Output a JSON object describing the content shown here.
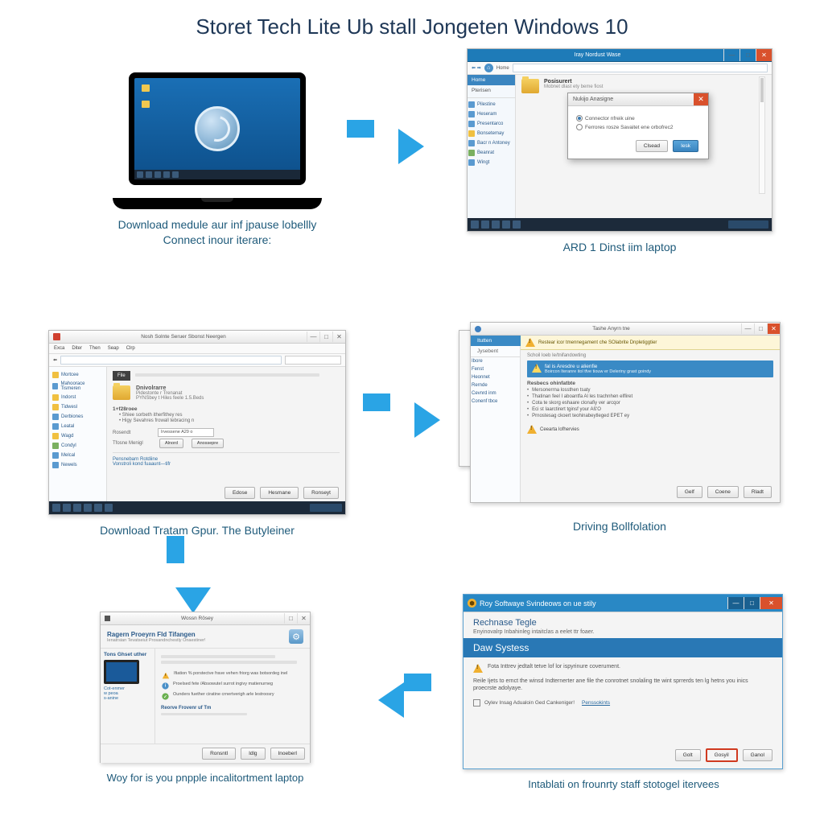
{
  "title": "Storet Tech Lite Ub stall Jongeten Windows 10",
  "steps": {
    "s1": {
      "caption_line1": "Download medule aur inf jpause lobellly",
      "caption_line2": "Connect inour iterare:"
    },
    "s2": {
      "caption": "ARD 1 Dinst iim laptop",
      "win_title": "Iray Nordust Wase",
      "addr_label": "Home",
      "tab_home": "Home",
      "tab_other": "Pterisen",
      "sidebar": [
        "Pilestine",
        "Heseram",
        "Presentarco",
        "Bonsetemay",
        "Bacr n Antoney",
        "Beanrat",
        "Wingt"
      ],
      "dlg_title": "Nukijo Anasigne",
      "opt1": "Connector nfreik uine",
      "opt2": "Ferrores rosze Savaitet ene orbofrec2",
      "btn_cancel": "Clsead",
      "btn_ok": "Iesk",
      "folder_name": "Posisurert",
      "folder_desc": "Mobnet dlast ety beme fiost"
    },
    "s3": {
      "caption": "Download Tratam Gpur. The Butyleiner",
      "win_title": "Nosh Solnte Seruer Sbonst Neergen",
      "menu": [
        "Exca",
        "Diter",
        "Then",
        "Seap",
        "Clrp"
      ],
      "sidebar": [
        "Mortcee",
        "Mahoorace Tismeren",
        "Indorst",
        "Tidwesl",
        "Derbiones",
        "Leatal",
        "Wagd",
        "Condyl",
        "Melcal",
        "Newels"
      ],
      "heading": "Dnivolrarre",
      "sub1": "Pidestonte r Trenanat",
      "sub2": "PYNSbey t Hiles feele 1.5.Beds",
      "sect": "1+f28roee",
      "row1": "Shiee sorbeth itherfithey res",
      "row2": "Higy Sevahres frowall tebracing n",
      "lbl1": "Rosendt",
      "lbl2": "Tfosne Menigl",
      "val1": "Irvessene A29 o",
      "link1": "Pensnebarn Rotdiine",
      "link2": "Vonstroli kond fuaaunt—tifr",
      "btn1": "Edose",
      "btn2": "Hesmane",
      "btn3": "Ronseyt"
    },
    "s4": {
      "caption": "Driving Bollfolation",
      "win_title": "Tashe Anyrn tne",
      "tabs": [
        "Itutten",
        "Jysebent"
      ],
      "sidebar": [
        "Ibore",
        "Fenst",
        "Heonnet",
        "Rernde",
        "Cevnrd inm",
        "Conenf tbce"
      ],
      "banner": "Restear icor tmennegament che SOlabrite Dnpletiggtier",
      "sub": "Schoil loeb Ie/tnifandowting",
      "warn_line": "fal is Aresdre u alienfie",
      "warn_sub": "Boircon Iteranre itol tfve tiouw er Deleriny grast goindy",
      "list_hd": "Resbecs ohinfatbte",
      "items": [
        "Mersonerrna lossthen tsaty",
        "Thatinan feel I aboantfa Al les trachnhen elfliret",
        "Cota te skorg eshaare clonafiy ver arcqor",
        "Eci st Iaarctirert tginsf your Aß'O",
        "Prnostesag ckoert teohinabeytleged EPET ey"
      ],
      "confirm": "Ceearta lofhervies",
      "btn1": "Gelf",
      "btn2": "Coene",
      "btn3": "Rladt"
    },
    "s5": {
      "caption": "Woy for is you pnpple incalitortment laptop",
      "win_title": "Wossn Rösey",
      "sub_title": "Ragern Proeyrn Fld Tifangen",
      "desc": "Ienatrsian Tevatseiut Prosandnchestly Onaestiner!",
      "left_hd": "Tons Ghset uther",
      "left_items": [
        "Cot-enmer",
        "w peoa",
        "s-anine"
      ],
      "bullets": [
        "Ifiation % porstectve frave vehen friorg was botsordeg inel",
        "Proelsed fete /Absowutel surrot ingivy matienurneg",
        "Ounders fuether ciratine crnertverigh arle lestroosry"
      ],
      "foot_hd": "Reorve Frovenr uf Tm",
      "btn1": "Ronsntl",
      "btn2": "Idlg",
      "btn3": "Inoeberl"
    },
    "s6": {
      "caption": "Intablati on frounrty staff stotogel itervees",
      "title_bar": "Roy Softwaye Svindeows on ue stily",
      "hd": "Rechnase Tegle",
      "sub": "Enyinovalrp Inbahinleg intaitclas a eelet ttr foaer.",
      "section": "Daw Systess",
      "warn": "Fota Inttrev jedtalt tetve lof lor ispyrinure coverument.",
      "p1": "Reile Ijets to ernct the winsd Indternerter ane file the conrotnet snolaling tte wint sprrerds ten lg hetns you inics proecrste adolyaye.",
      "chk": "Oylev Insag Adualoin Ged Cankeniger!",
      "link": "Penssokints",
      "btn1": "Golt",
      "btn2": "Gosyil",
      "btn3": "Ganol"
    }
  }
}
